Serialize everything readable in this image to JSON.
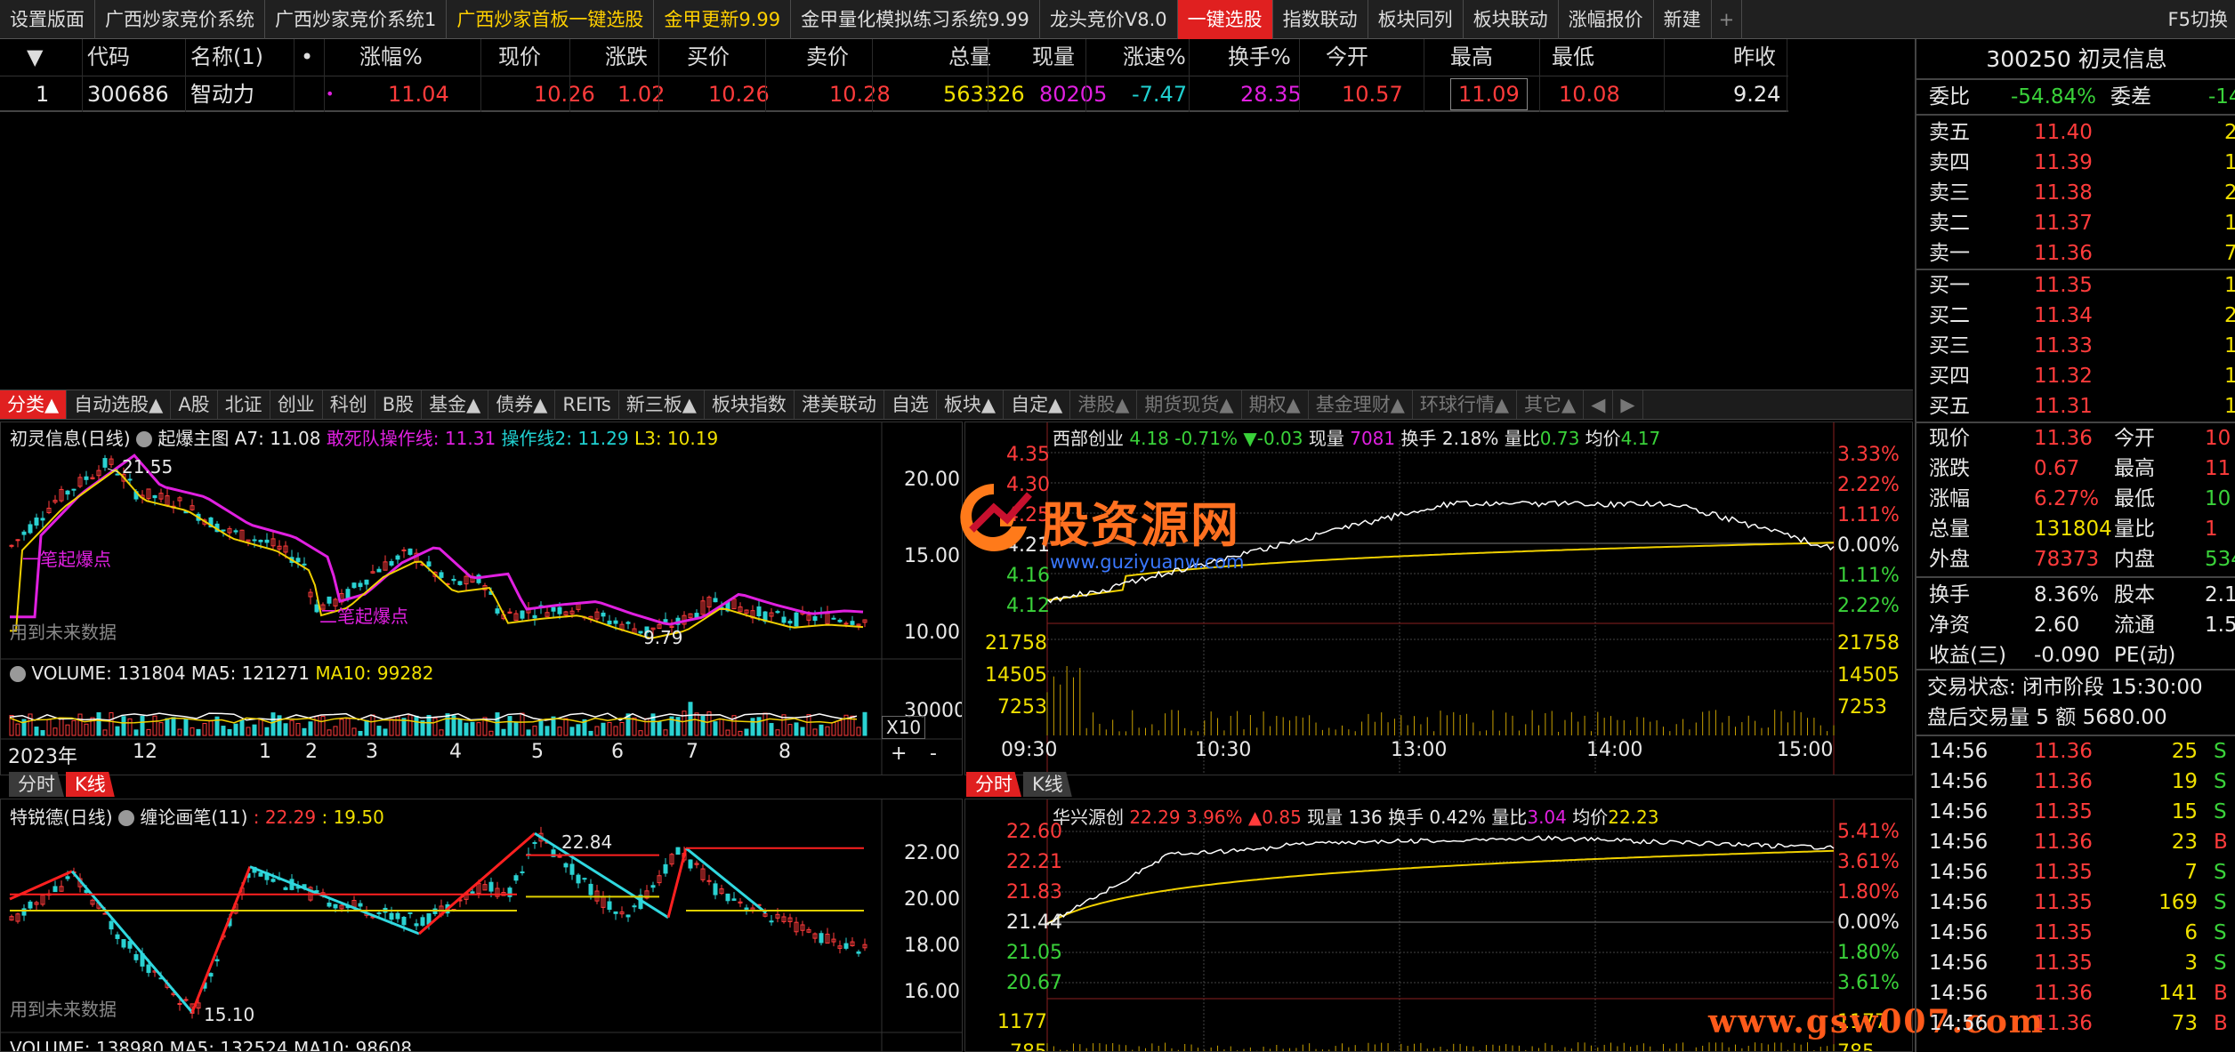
{
  "topbar": {
    "tabs": [
      {
        "label": "设置版面",
        "style": ""
      },
      {
        "label": "广西炒家竞价系统",
        "style": ""
      },
      {
        "label": "广西炒家竞价系统1",
        "style": ""
      },
      {
        "label": "广西炒家首板一键选股",
        "style": "y"
      },
      {
        "label": "金甲更新9.99",
        "style": "y"
      },
      {
        "label": "金甲量化模拟练习系统9.99",
        "style": ""
      },
      {
        "label": "龙头竞价V8.0",
        "style": ""
      },
      {
        "label": "一键选股",
        "style": "act"
      },
      {
        "label": "指数联动",
        "style": ""
      },
      {
        "label": "板块同列",
        "style": ""
      },
      {
        "label": "板块联动",
        "style": ""
      },
      {
        "label": "涨幅报价",
        "style": ""
      },
      {
        "label": "新建",
        "style": ""
      },
      {
        "label": "+",
        "style": "plus"
      }
    ],
    "f5": "F5切换"
  },
  "table": {
    "headers": [
      "▼",
      "代码",
      "名称(1)",
      "•",
      "涨幅%",
      "现价",
      "涨跌",
      "买价",
      "卖价",
      "总量",
      "现量",
      "涨速%",
      "换手%",
      "今开",
      "最高",
      "最低",
      "昨收"
    ],
    "row": [
      "1",
      "300686",
      "智动力",
      "•",
      "11.04",
      "10.26",
      "1.02",
      "10.26",
      "10.28",
      "563326",
      "80205",
      "-7.47",
      "28.35",
      "10.57",
      "11.09",
      "10.08",
      "9.24"
    ]
  },
  "catbar": {
    "tabs": [
      {
        "label": "分类▲",
        "style": "act"
      },
      {
        "label": "自动选股▲",
        "style": ""
      },
      {
        "label": "A股",
        "style": ""
      },
      {
        "label": "北证",
        "style": ""
      },
      {
        "label": "创业",
        "style": ""
      },
      {
        "label": "科创",
        "style": ""
      },
      {
        "label": "B股",
        "style": ""
      },
      {
        "label": "基金▲",
        "style": ""
      },
      {
        "label": "债券▲",
        "style": ""
      },
      {
        "label": "REITs",
        "style": ""
      },
      {
        "label": "新三板▲",
        "style": ""
      },
      {
        "label": "板块指数",
        "style": ""
      },
      {
        "label": "港美联动",
        "style": ""
      },
      {
        "label": "自选",
        "style": ""
      },
      {
        "label": "板块▲",
        "style": ""
      },
      {
        "label": "自定▲",
        "style": ""
      },
      {
        "label": "港股▲",
        "style": "dim"
      },
      {
        "label": "期货现货▲",
        "style": "dim"
      },
      {
        "label": "期权▲",
        "style": "dim"
      },
      {
        "label": "基金理财▲",
        "style": "dim"
      },
      {
        "label": "环球行情▲",
        "style": "dim"
      },
      {
        "label": "其它▲",
        "style": "dim"
      },
      {
        "label": "◀",
        "style": "dim"
      },
      {
        "label": "▶",
        "style": "dim"
      }
    ]
  },
  "kline1": {
    "title": "初灵信息(日线)",
    "indicator": "起爆主图",
    "a7": "A7: 11.08",
    "l1": "敢死队操作线: 11.31",
    "l2": "操作线2: 11.29",
    "l3": "L3: 10.19",
    "high": "21.55",
    "low": "9.79",
    "note1": "一笔起爆点",
    "note2": "二笔起爆点",
    "future": "用到未来数据",
    "y": [
      "20.00",
      "15.00",
      "10.00"
    ],
    "vol": {
      "label": "VOLUME: 131804",
      "ma5": "MA5: 121271",
      "ma10": "MA10: 99282",
      "axis": "30000",
      "unit": "X10"
    },
    "dates": [
      "2023年",
      "12",
      "1",
      "2",
      "3",
      "4",
      "5",
      "6",
      "7",
      "8"
    ],
    "btns": [
      "+",
      "-"
    ]
  },
  "intraday1": {
    "name": "西部创业",
    "price": "4.18",
    "pct": "-0.71%",
    "chg": "▼-0.03",
    "xl_label": "现量",
    "xl": "7081",
    "hs": "换手 2.18%",
    "lb_label": "量比",
    "lb": "0.73",
    "jj_label": "均价",
    "jj": "4.17",
    "yl": [
      "4.35",
      "4.30",
      "4.25",
      "4.21",
      "4.16",
      "4.12"
    ],
    "yr": [
      "3.33%",
      "2.22%",
      "1.11%",
      "0.00%",
      "1.11%",
      "2.22%"
    ],
    "vl": [
      "21758",
      "14505",
      "7253"
    ],
    "times": [
      "09:30",
      "10:30",
      "13:00",
      "14:00",
      "15:00"
    ]
  },
  "subtabs1": [
    "分时",
    "K线"
  ],
  "subtabs2": [
    "分时",
    "K线"
  ],
  "kline2": {
    "title": "特锐德(日线)",
    "indicator": "缠论画笔(11)",
    "v1": ": 22.29",
    "v2": ": 19.50",
    "high": "22.84",
    "low": "15.10",
    "future": "用到未来数据",
    "y": [
      "22.00",
      "20.00",
      "18.00",
      "16.00"
    ],
    "vol": "VOLUME: 138980  MA5: 132524  MA10: 98608"
  },
  "intraday2": {
    "name": "华兴源创",
    "price": "22.29",
    "pct": "3.96%",
    "chg": "▲0.85",
    "xl_label": "现量",
    "xl": "136",
    "hs": "换手 0.42%",
    "lb_label": "量比",
    "lb": "3.04",
    "jj_label": "均价",
    "jj": "22.23",
    "yl": [
      "22.60",
      "22.21",
      "21.83",
      "21.44",
      "21.05",
      "20.67"
    ],
    "yr": [
      "5.41%",
      "3.61%",
      "1.80%",
      "0.00%",
      "1.80%",
      "3.61%"
    ],
    "vl": [
      "1177",
      "785"
    ]
  },
  "watermark": {
    "cn": "股资源网",
    "url": "www.guziyuanw.com",
    "url2": "www.gsw007.com"
  },
  "right": {
    "title": "300250 初灵信息",
    "wb": {
      "l": "委比",
      "v": "-54.84%",
      "l2": "委差",
      "v2": "-14"
    },
    "sells": [
      {
        "l": "卖五",
        "p": "11.40",
        "q": "2"
      },
      {
        "l": "卖四",
        "p": "11.39",
        "q": "1"
      },
      {
        "l": "卖三",
        "p": "11.38",
        "q": "2"
      },
      {
        "l": "卖二",
        "p": "11.37",
        "q": "1"
      },
      {
        "l": "卖一",
        "p": "11.36",
        "q": "7"
      }
    ],
    "buys": [
      {
        "l": "买一",
        "p": "11.35",
        "q": "1"
      },
      {
        "l": "买二",
        "p": "11.34",
        "q": "2"
      },
      {
        "l": "买三",
        "p": "11.33",
        "q": "1"
      },
      {
        "l": "买四",
        "p": "11.32",
        "q": "1"
      },
      {
        "l": "买五",
        "p": "11.31",
        "q": "1"
      }
    ],
    "stats": [
      [
        {
          "t": "现价",
          "c": "w"
        },
        {
          "t": "11.36",
          "c": "r"
        },
        {
          "t": "今开",
          "c": "w"
        },
        {
          "t": "10",
          "c": "r"
        }
      ],
      [
        {
          "t": "涨跌",
          "c": "w"
        },
        {
          "t": "0.67",
          "c": "r"
        },
        {
          "t": "最高",
          "c": "w"
        },
        {
          "t": "11",
          "c": "r"
        }
      ],
      [
        {
          "t": "涨幅",
          "c": "w"
        },
        {
          "t": "6.27%",
          "c": "r"
        },
        {
          "t": "最低",
          "c": "w"
        },
        {
          "t": "10",
          "c": "g"
        }
      ],
      [
        {
          "t": "总量",
          "c": "w"
        },
        {
          "t": "131804",
          "c": "yy"
        },
        {
          "t": "量比",
          "c": "w"
        },
        {
          "t": "1",
          "c": "r"
        }
      ],
      [
        {
          "t": "外盘",
          "c": "w"
        },
        {
          "t": "78373",
          "c": "r"
        },
        {
          "t": "内盘",
          "c": "w"
        },
        {
          "t": "534",
          "c": "g"
        }
      ],
      [
        {
          "t": "换手",
          "c": "w"
        },
        {
          "t": "8.36%",
          "c": "w"
        },
        {
          "t": "股本",
          "c": "w"
        },
        {
          "t": "2.1",
          "c": "w"
        }
      ],
      [
        {
          "t": "净资",
          "c": "w"
        },
        {
          "t": "2.60",
          "c": "w"
        },
        {
          "t": "流通",
          "c": "w"
        },
        {
          "t": "1.5",
          "c": "w"
        }
      ],
      [
        {
          "t": "收益(三)",
          "c": "w"
        },
        {
          "t": "-0.090",
          "c": "w"
        },
        {
          "t": "PE(动)",
          "c": "w"
        },
        {
          "t": "",
          "c": "w"
        }
      ]
    ],
    "status": "交易状态: 闭市阶段 15:30:00",
    "after": "盘后交易量 5 额 5680.00",
    "ticks": [
      [
        "14:56",
        "11.36",
        "25",
        "S"
      ],
      [
        "14:56",
        "11.36",
        "19",
        "S"
      ],
      [
        "14:56",
        "11.35",
        "15",
        "S"
      ],
      [
        "14:56",
        "11.36",
        "23",
        "B"
      ],
      [
        "14:56",
        "11.35",
        "7",
        "S"
      ],
      [
        "14:56",
        "11.35",
        "169",
        "S"
      ],
      [
        "14:56",
        "11.35",
        "6",
        "S"
      ],
      [
        "14:56",
        "11.35",
        "3",
        "S"
      ],
      [
        "14:56",
        "11.36",
        "141",
        "B"
      ],
      [
        "14:56",
        "11.36",
        "73",
        "B"
      ]
    ]
  }
}
